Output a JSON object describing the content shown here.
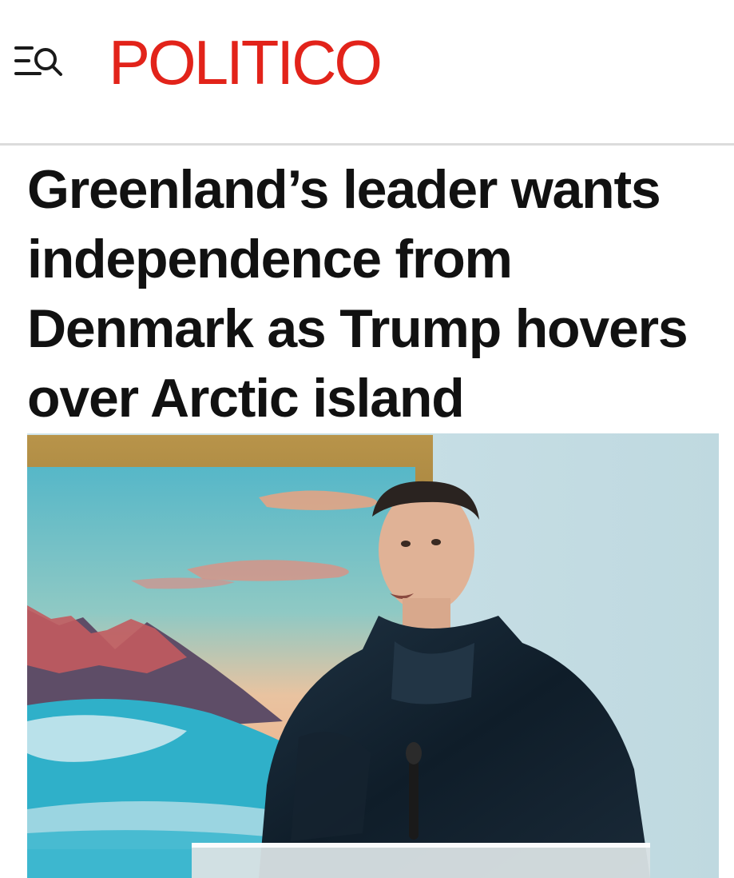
{
  "header": {
    "menu_icon": "menu-search-icon",
    "brand": "POLITICO",
    "brand_color": "#e2231a"
  },
  "article": {
    "headline": "Greenland’s leader wants independence from Denmark as Trump hovers over Arctic island",
    "hero_image": "photo of a man in a dark anorak speaking at a podium in front of a mountain painting"
  }
}
